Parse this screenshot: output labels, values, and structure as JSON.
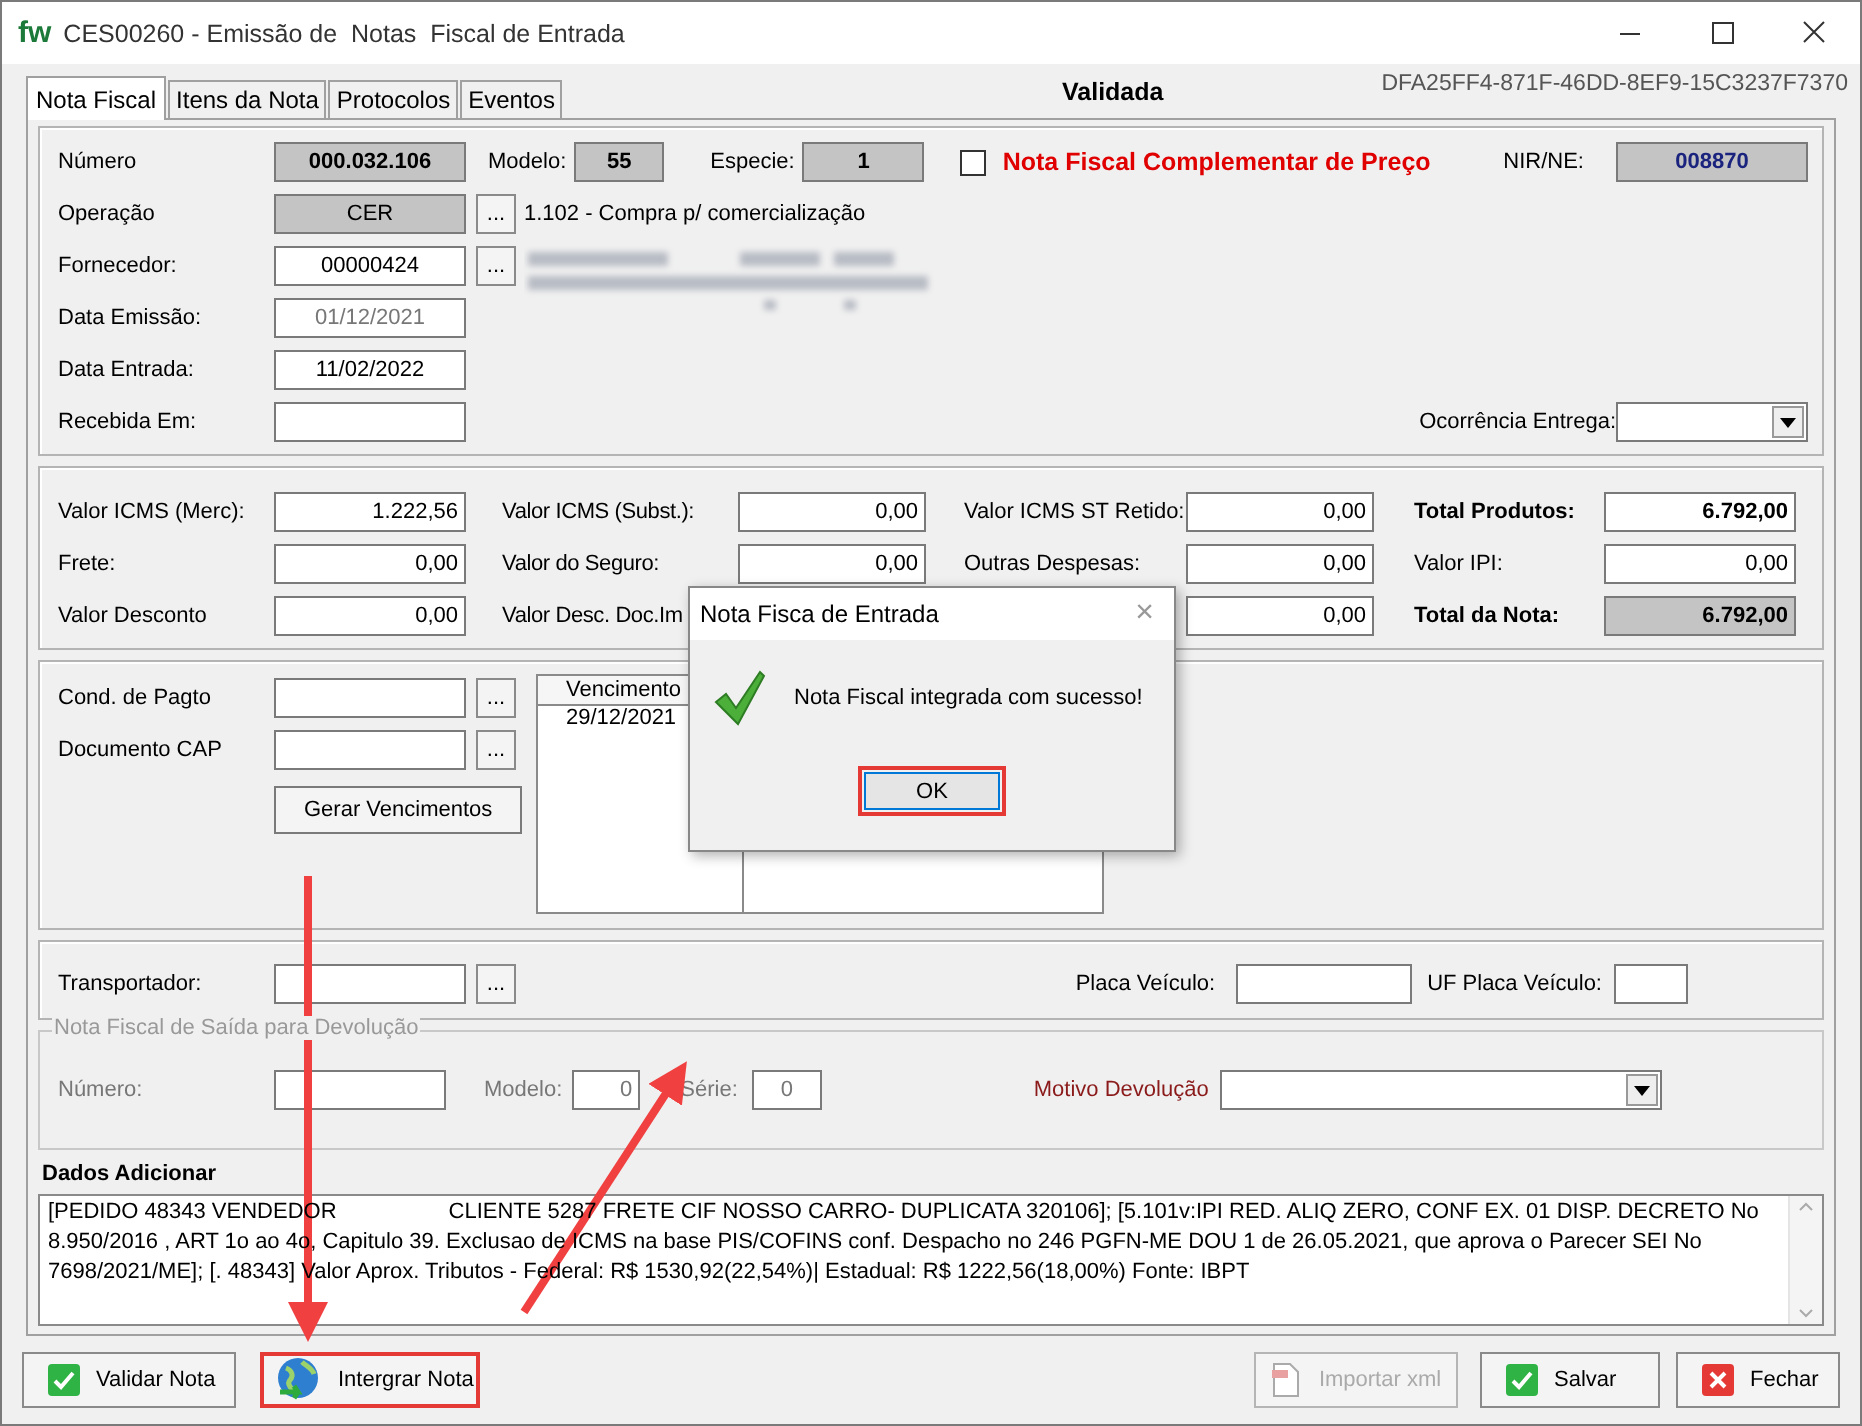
{
  "window": {
    "logo": "fw",
    "title": "CES00260 - Emissão de  Notas  Fiscal de Entrada"
  },
  "tabs": [
    {
      "label": "Nota Fiscal",
      "selected": true
    },
    {
      "label": "Itens da Nota",
      "selected": false
    },
    {
      "label": "Protocolos",
      "selected": false
    },
    {
      "label": "Eventos",
      "selected": false
    }
  ],
  "status": "Validada",
  "guid": "DFA25FF4-871F-46DD-8EF9-15C3237F7370",
  "header": {
    "numero_label": "Número",
    "numero": "000.032.106",
    "modelo_label": "Modelo:",
    "modelo": "55",
    "especie_label": "Especie:",
    "especie": "1",
    "complementar_label": "Nota Fiscal Complementar de Preço",
    "complementar_checked": false,
    "nir_label": "NIR/NE:",
    "nir": "008870",
    "operacao_label": "Operação",
    "operacao": "CER",
    "ellipsis": "...",
    "operacao_desc": "1.102 - Compra p/ comercialização",
    "fornecedor_label": "Fornecedor:",
    "fornecedor": "00000424",
    "emissao_label": "Data Emissão:",
    "emissao": "01/12/2021",
    "entrada_label": "Data Entrada:",
    "entrada": "11/02/2022",
    "recebida_label": "Recebida Em:",
    "ocorrencia_label": "Ocorrência Entrega:"
  },
  "values": {
    "columns": [
      [
        {
          "label": "Valor ICMS (Merc):",
          "value": "1.222,56"
        },
        {
          "label": "Frete:",
          "value": "0,00"
        },
        {
          "label": "Valor Desconto",
          "value": "0,00"
        }
      ],
      [
        {
          "label": "Valor  ICMS (Subst.):",
          "value": "0,00"
        },
        {
          "label": "Valor do Seguro:",
          "value": "0,00"
        },
        {
          "label": "Valor Desc. Doc.Im"
        }
      ],
      [
        {
          "label": "Valor ICMS ST Retido:",
          "value": "0,00"
        },
        {
          "label": "Outras Despesas:",
          "value": "0,00"
        },
        {
          "value": "0,00"
        }
      ]
    ],
    "totals": [
      {
        "label": "Total Produtos:",
        "value": "6.792,00",
        "bold": true,
        "readonly": false
      },
      {
        "label": "Valor IPI:",
        "value": "0,00",
        "bold": false,
        "readonly": false
      },
      {
        "label": "Total da Nota:",
        "value": "6.792,00",
        "bold": true,
        "readonly": true
      }
    ]
  },
  "payment": {
    "cond_label": "Cond. de Pagto",
    "cap_label": "Documento CAP",
    "ellipsis": "...",
    "generate_button": "Gerar Vencimentos",
    "list_header": "Vencimento",
    "list_rows": [
      "29/12/2021"
    ]
  },
  "transport": {
    "label": "Transportador:",
    "ellipsis": "...",
    "placa_label": "Placa Veículo:",
    "uf_label": "UF Placa Veículo:"
  },
  "return": {
    "legend": "Nota Fiscal de Saída para Devolução",
    "numero_label": "Número:",
    "modelo_label": "Modelo:",
    "modelo": "0",
    "serie_label": "Série:",
    "serie": "0",
    "motivo_label": "Motivo Devolução"
  },
  "notes": {
    "label": "Dados Adicionar",
    "text_before": "[PEDIDO 48343 VENDEDOR",
    "text_after": "CLIENTE 5287 FRETE CIF NOSSO CARRO- DUPLICATA 320106];  [5.101v:IPI RED. ALIQ ZERO, CONF EX. 01 DISP. DECRETO No 8.950/2016 , ART 1o ao 4o, Capitulo 39. Exclusao de ICMS na base PIS/COFINS conf. Despacho no 246 PGFN-ME DOU 1 de 26.05.2021, que aprova o Parecer SEI No 7698/2021/ME];  [. 48343] Valor Aprox. Tributos -  Federal: R$ 1530,92(22,54%)|  Estadual: R$ 1222,56(18,00%) Fonte: IBPT"
  },
  "buttons": [
    {
      "label": "Validar Nota",
      "kind": "validate",
      "disabled": false,
      "highlighted": false
    },
    {
      "label": "Intergrar Nota",
      "kind": "integrate",
      "disabled": false,
      "highlighted": true
    },
    {
      "label": "Importar xml",
      "kind": "import",
      "disabled": true,
      "highlighted": false
    },
    {
      "label": "Salvar",
      "kind": "save",
      "disabled": false,
      "highlighted": false
    },
    {
      "label": "Fechar",
      "kind": "close",
      "disabled": false,
      "highlighted": false
    }
  ],
  "dialog": {
    "title": "Nota Fisca de Entrada",
    "close": "×",
    "message": "Nota Fiscal integrada com sucesso!",
    "ok": "OK",
    "ok_highlighted": true
  }
}
